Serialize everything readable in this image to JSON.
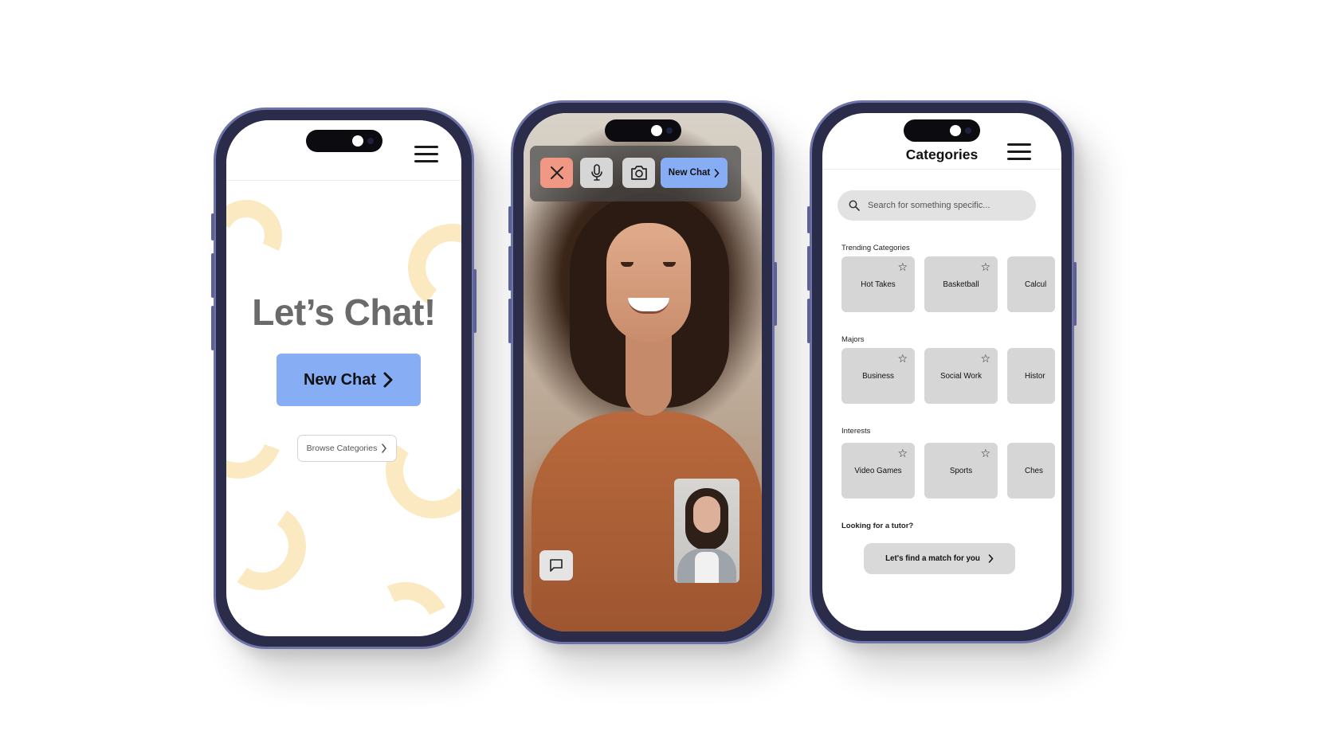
{
  "welcome_screen": {
    "title": "Let’s Chat!",
    "new_chat_label": "New Chat",
    "browse_label": "Browse Categories"
  },
  "call_screen": {
    "new_chat_label": "New Chat",
    "icons": [
      "close-icon",
      "microphone-icon",
      "camera-icon",
      "chevron-right-icon",
      "chat-bubble-icon"
    ]
  },
  "categories_screen": {
    "title": "Categories",
    "search_placeholder": "Search for something specific...",
    "sections": [
      {
        "label": "Trending Categories",
        "items": [
          "Hot Takes",
          "Basketball",
          "Calcul"
        ]
      },
      {
        "label": "Majors",
        "items": [
          "Business",
          "Social Work",
          "Histor"
        ]
      },
      {
        "label": "Interests",
        "items": [
          "Video Games",
          "Sports",
          "Ches"
        ]
      }
    ],
    "tutor_prompt": "Looking for a tutor?",
    "match_label": "Let's find a match for you"
  },
  "colors": {
    "accent_blue": "#87ADF5",
    "end_call": "#F09883",
    "decor_yellow": "#FBE9C2",
    "chassis": "#2A2C4A"
  }
}
